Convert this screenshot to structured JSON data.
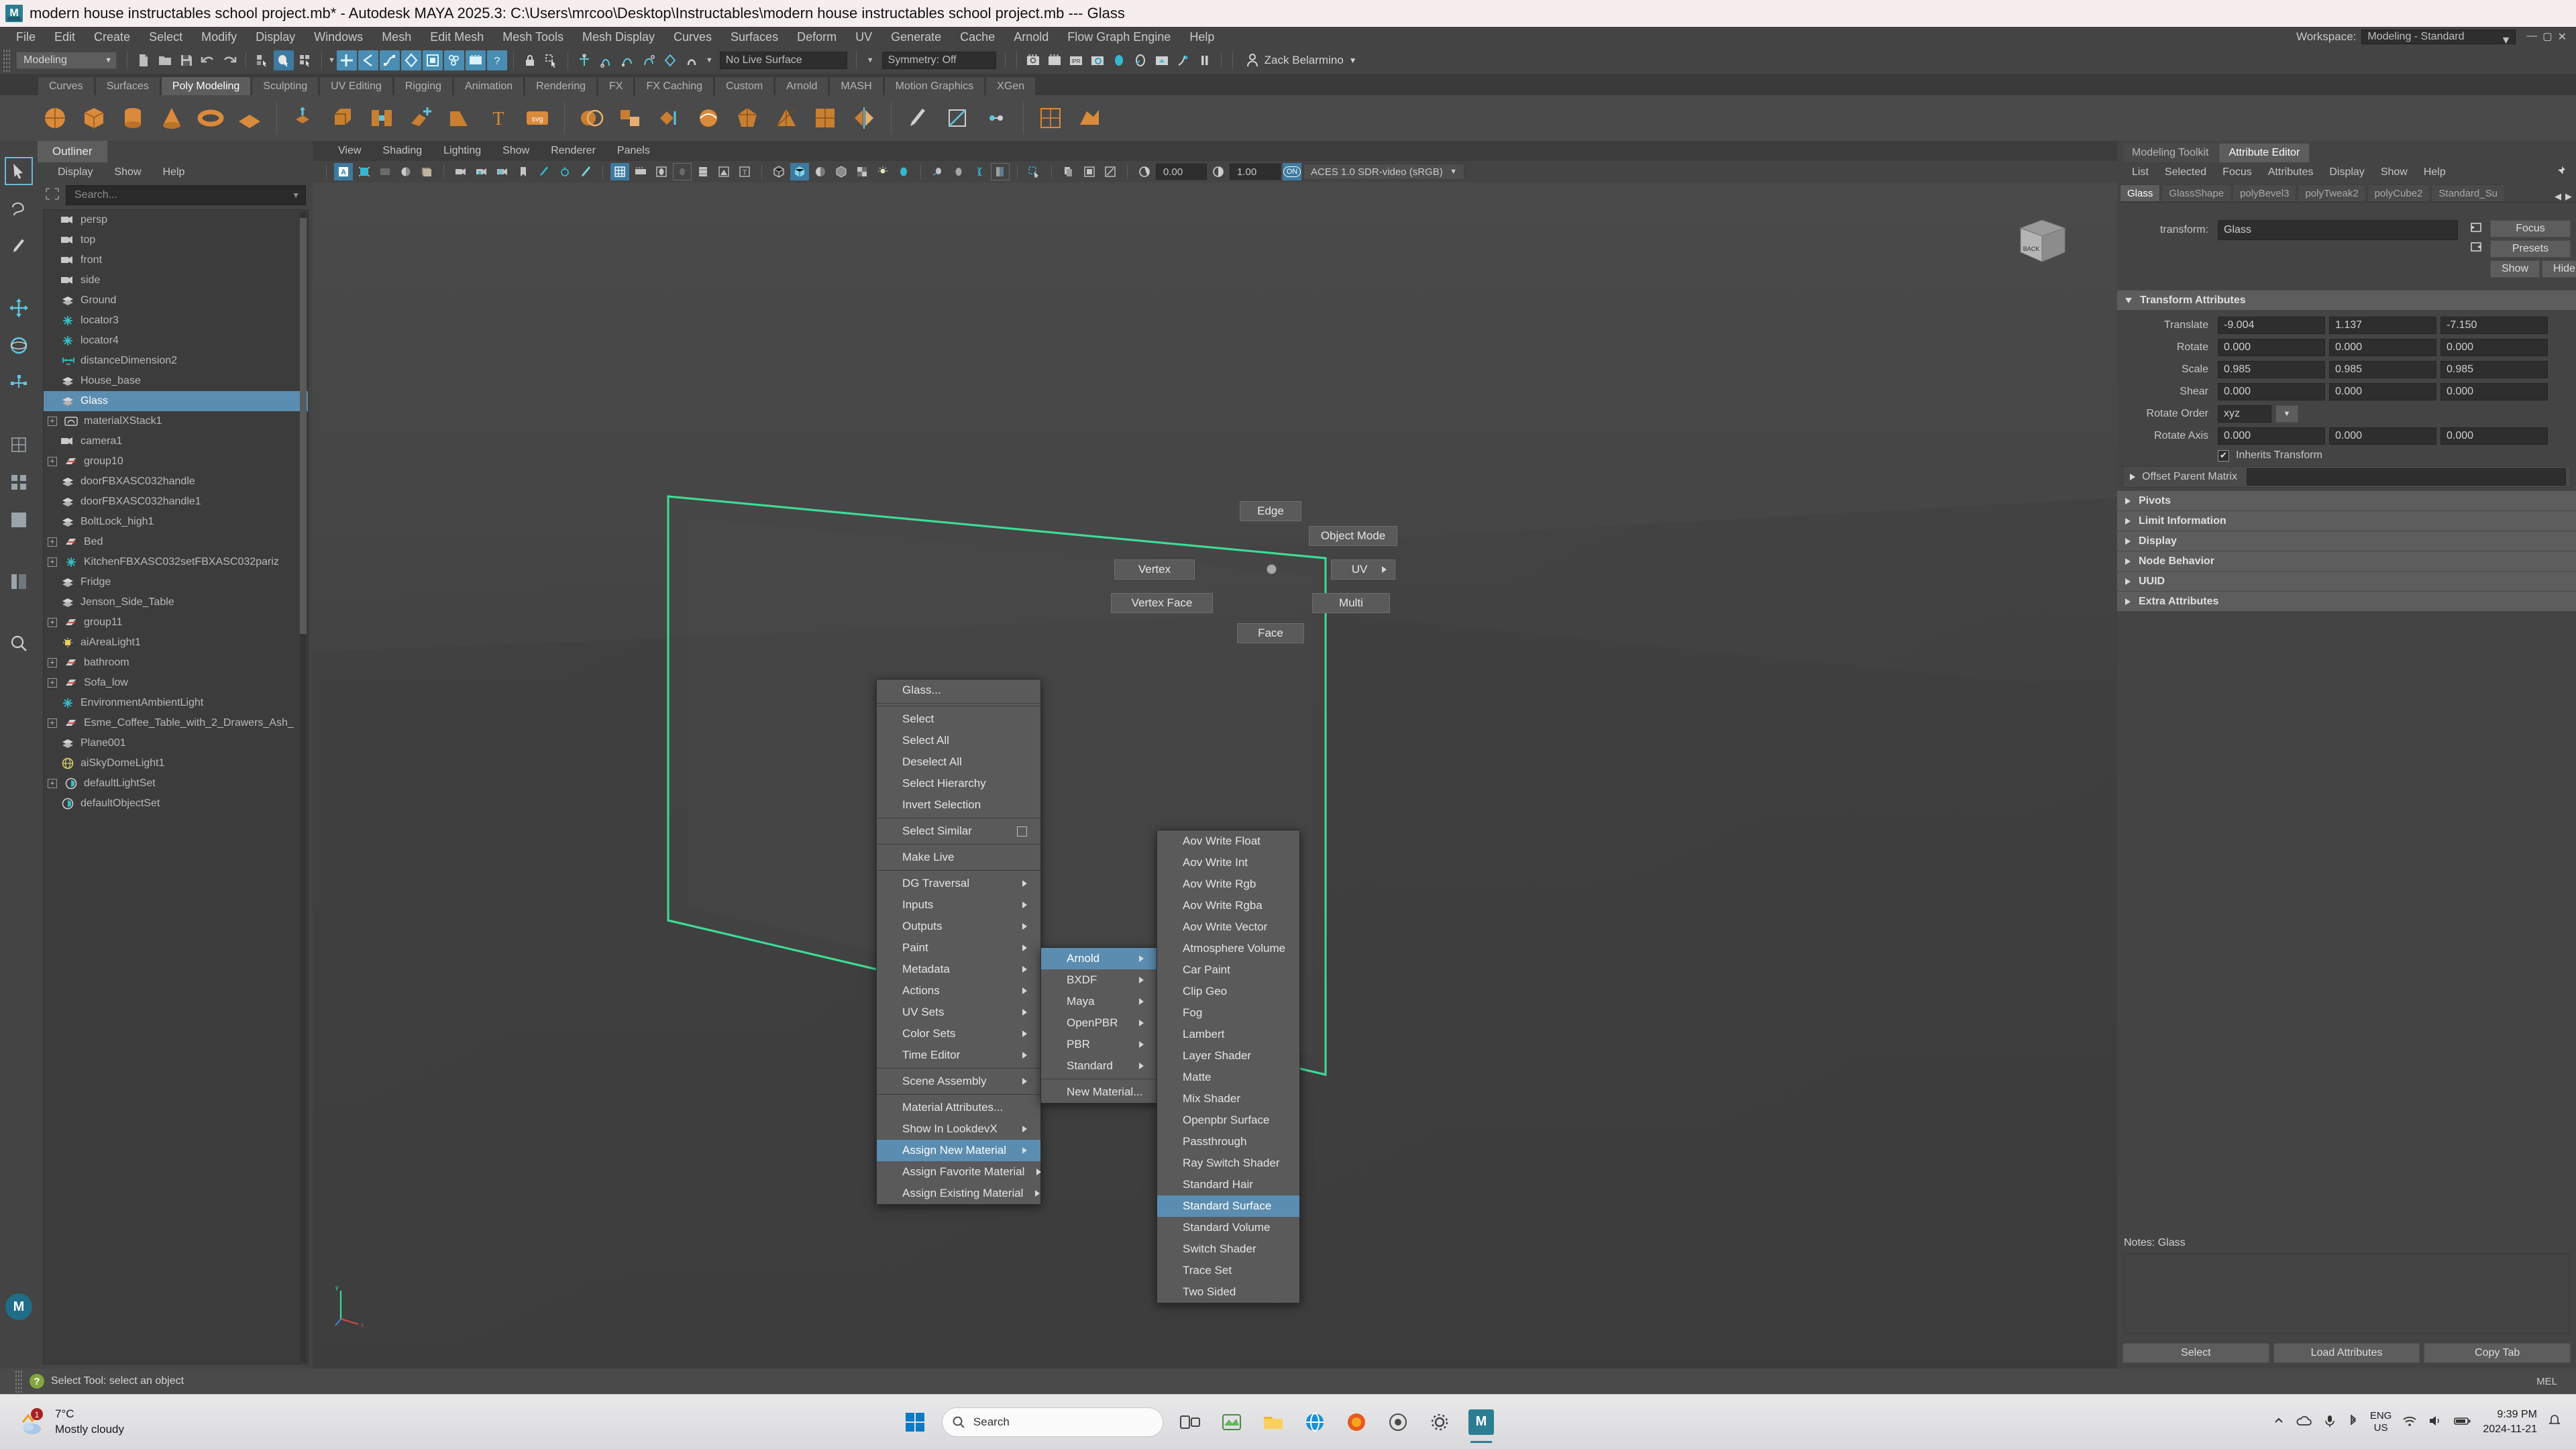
{
  "titlebar": {
    "text": "modern house instructables school project.mb* - Autodesk MAYA 2025.3: C:\\Users\\mrcoo\\Desktop\\Instructables\\modern house instructables school project.mb   ---   Glass",
    "logo": "M"
  },
  "menubar": {
    "items": [
      "File",
      "Edit",
      "Create",
      "Select",
      "Modify",
      "Display",
      "Windows",
      "Mesh",
      "Edit Mesh",
      "Mesh Tools",
      "Mesh Display",
      "Curves",
      "Surfaces",
      "Deform",
      "UV",
      "Generate",
      "Cache",
      "Arnold",
      "Flow Graph Engine",
      "Help"
    ],
    "workspace_label": "Workspace:",
    "workspace_value": "Modeling - Standard"
  },
  "statusline": {
    "menuset": "Modeling",
    "live_surface": "No Live Surface",
    "symmetry": "Symmetry: Off",
    "user": "Zack Belarmino"
  },
  "shelf": {
    "tabs": [
      "Curves",
      "Surfaces",
      "Poly Modeling",
      "Sculpting",
      "UV Editing",
      "Rigging",
      "Animation",
      "Rendering",
      "FX",
      "FX Caching",
      "Custom",
      "Arnold",
      "MASH",
      "Motion Graphics",
      "XGen"
    ],
    "active_tab": "Poly Modeling"
  },
  "outliner": {
    "tab": "Outliner",
    "menus": [
      "Display",
      "Show",
      "Help"
    ],
    "search_placeholder": "Search...",
    "items": [
      {
        "label": "persp",
        "icon": "camera-icon",
        "expandable": false,
        "selected": false
      },
      {
        "label": "top",
        "icon": "camera-icon",
        "expandable": false,
        "selected": false
      },
      {
        "label": "front",
        "icon": "camera-icon",
        "expandable": false,
        "selected": false
      },
      {
        "label": "side",
        "icon": "camera-icon",
        "expandable": false,
        "selected": false
      },
      {
        "label": "Ground",
        "icon": "mesh-icon",
        "expandable": false,
        "selected": false
      },
      {
        "label": "locator3",
        "icon": "locator-icon",
        "expandable": false,
        "selected": false
      },
      {
        "label": "locator4",
        "icon": "locator-icon",
        "expandable": false,
        "selected": false
      },
      {
        "label": "distanceDimension2",
        "icon": "distance-icon",
        "expandable": false,
        "selected": false
      },
      {
        "label": "House_base",
        "icon": "mesh-icon",
        "expandable": false,
        "selected": false
      },
      {
        "label": "Glass",
        "icon": "mesh-icon",
        "expandable": false,
        "selected": true
      },
      {
        "label": "materialXStack1",
        "icon": "materialx-icon",
        "expandable": true,
        "selected": false
      },
      {
        "label": "camera1",
        "icon": "camera-icon",
        "expandable": false,
        "selected": false
      },
      {
        "label": "group10",
        "icon": "group-icon",
        "expandable": true,
        "selected": false
      },
      {
        "label": "doorFBXASC032handle",
        "icon": "mesh-icon",
        "expandable": false,
        "selected": false
      },
      {
        "label": "doorFBXASC032handle1",
        "icon": "mesh-icon",
        "expandable": false,
        "selected": false
      },
      {
        "label": "BoltLock_high1",
        "icon": "mesh-icon",
        "expandable": false,
        "selected": false
      },
      {
        "label": "Bed",
        "icon": "group-icon",
        "expandable": true,
        "selected": false
      },
      {
        "label": "KitchenFBXASC032setFBXASC032pariz",
        "icon": "locator-icon",
        "expandable": true,
        "selected": false
      },
      {
        "label": "Fridge",
        "icon": "mesh-icon",
        "expandable": false,
        "selected": false
      },
      {
        "label": "Jenson_Side_Table",
        "icon": "mesh-icon",
        "expandable": false,
        "selected": false
      },
      {
        "label": "group11",
        "icon": "group-icon",
        "expandable": true,
        "selected": false
      },
      {
        "label": "aiAreaLight1",
        "icon": "arealight-icon",
        "expandable": false,
        "selected": false
      },
      {
        "label": "bathroom",
        "icon": "group-icon",
        "expandable": true,
        "selected": false
      },
      {
        "label": "Sofa_low",
        "icon": "group-icon",
        "expandable": true,
        "selected": false
      },
      {
        "label": "EnvironmentAmbientLight",
        "icon": "locator-icon",
        "expandable": false,
        "selected": false
      },
      {
        "label": "Esme_Coffee_Table_with_2_Drawers_Ash_",
        "icon": "group-icon",
        "expandable": true,
        "selected": false
      },
      {
        "label": "Plane001",
        "icon": "mesh-icon",
        "expandable": false,
        "selected": false
      },
      {
        "label": "aiSkyDomeLight1",
        "icon": "skydome-icon",
        "expandable": false,
        "selected": false
      },
      {
        "label": "defaultLightSet",
        "icon": "set-icon",
        "expandable": true,
        "selected": false
      },
      {
        "label": "defaultObjectSet",
        "icon": "set-icon",
        "expandable": false,
        "selected": false
      }
    ]
  },
  "viewport": {
    "menus": [
      "View",
      "Shading",
      "Lighting",
      "Show",
      "Renderer",
      "Panels"
    ],
    "exposure": "0.00",
    "gamma": "1.00",
    "color_toggle": "ON",
    "colorspace": "ACES 1.0 SDR-video (sRGB)",
    "viewcube_label": "BACK"
  },
  "marking_menu": {
    "edge": "Edge",
    "object_mode": "Object Mode",
    "vertex": "Vertex",
    "uv": "UV",
    "vertex_face": "Vertex Face",
    "multi": "Multi",
    "face": "Face"
  },
  "context_menu": {
    "header": "Glass...",
    "items": [
      {
        "label": "Select",
        "arrow": false,
        "sep_before": true
      },
      {
        "label": "Select All",
        "arrow": false
      },
      {
        "label": "Deselect All",
        "arrow": false
      },
      {
        "label": "Select Hierarchy",
        "arrow": false
      },
      {
        "label": "Invert Selection",
        "arrow": false
      },
      {
        "label": "Select Similar",
        "arrow": false,
        "checkbox": true,
        "sep_before": true
      },
      {
        "label": "Make Live",
        "arrow": false,
        "sep_before": true
      },
      {
        "label": "DG Traversal",
        "arrow": true,
        "sep_before": true
      },
      {
        "label": "Inputs",
        "arrow": true
      },
      {
        "label": "Outputs",
        "arrow": true
      },
      {
        "label": "Paint",
        "arrow": true
      },
      {
        "label": "Metadata",
        "arrow": true
      },
      {
        "label": "Actions",
        "arrow": true
      },
      {
        "label": "UV Sets",
        "arrow": true
      },
      {
        "label": "Color Sets",
        "arrow": true
      },
      {
        "label": "Time Editor",
        "arrow": true
      },
      {
        "label": "Scene Assembly",
        "arrow": true,
        "sep_before": true
      },
      {
        "label": "Material Attributes...",
        "arrow": false,
        "sep_before": true
      },
      {
        "label": "Show In LookdevX",
        "arrow": true
      },
      {
        "label": "Assign New Material",
        "arrow": true,
        "highlight": true
      },
      {
        "label": "Assign Favorite Material",
        "arrow": true
      },
      {
        "label": "Assign Existing Material",
        "arrow": true
      }
    ]
  },
  "submenu_material": {
    "items": [
      {
        "label": "Arnold",
        "arrow": true,
        "highlight": true
      },
      {
        "label": "BXDF",
        "arrow": true
      },
      {
        "label": "Maya",
        "arrow": true
      },
      {
        "label": "OpenPBR",
        "arrow": true
      },
      {
        "label": "PBR",
        "arrow": true
      },
      {
        "label": "Standard",
        "arrow": true
      },
      {
        "label": "New Material...",
        "arrow": false,
        "sep_before": true
      }
    ]
  },
  "submenu_arnold": {
    "items": [
      {
        "label": "Aov Write Float"
      },
      {
        "label": "Aov Write Int"
      },
      {
        "label": "Aov Write Rgb"
      },
      {
        "label": "Aov Write Rgba"
      },
      {
        "label": "Aov Write Vector"
      },
      {
        "label": "Atmosphere Volume"
      },
      {
        "label": "Car Paint"
      },
      {
        "label": "Clip Geo"
      },
      {
        "label": "Fog"
      },
      {
        "label": "Lambert"
      },
      {
        "label": "Layer Shader"
      },
      {
        "label": "Matte"
      },
      {
        "label": "Mix Shader"
      },
      {
        "label": "Openpbr Surface"
      },
      {
        "label": "Passthrough"
      },
      {
        "label": "Ray Switch Shader"
      },
      {
        "label": "Standard Hair"
      },
      {
        "label": "Standard Surface",
        "highlight": true
      },
      {
        "label": "Standard Volume"
      },
      {
        "label": "Switch Shader"
      },
      {
        "label": "Trace Set"
      },
      {
        "label": "Two Sided"
      }
    ]
  },
  "attribute_editor": {
    "tabs": [
      "Modeling Toolkit",
      "Attribute Editor"
    ],
    "active_tab": "Attribute Editor",
    "menus": [
      "List",
      "Selected",
      "Focus",
      "Attributes",
      "Display",
      "Show",
      "Help"
    ],
    "node_tabs": [
      "Glass",
      "GlassShape",
      "polyBevel3",
      "polyTweak2",
      "polyCube2",
      "Standard_Su"
    ],
    "active_node_tab": "Glass",
    "transform_label": "transform:",
    "transform_value": "Glass",
    "buttons": {
      "focus": "Focus",
      "presets": "Presets",
      "show": "Show",
      "hide": "Hide"
    },
    "section_title": "Transform Attributes",
    "rows": [
      {
        "label": "Translate",
        "values": [
          "-9.004",
          "1.137",
          "-7.150"
        ]
      },
      {
        "label": "Rotate",
        "values": [
          "0.000",
          "0.000",
          "0.000"
        ]
      },
      {
        "label": "Scale",
        "values": [
          "0.985",
          "0.985",
          "0.985"
        ]
      },
      {
        "label": "Shear",
        "values": [
          "0.000",
          "0.000",
          "0.000"
        ]
      }
    ],
    "rotate_order_label": "Rotate Order",
    "rotate_order_value": "xyz",
    "rotate_axis_label": "Rotate Axis",
    "rotate_axis_values": [
      "0.000",
      "0.000",
      "0.000"
    ],
    "inherits_label": "Inherits Transform",
    "offset_parent_label": "Offset Parent Matrix",
    "sections": [
      "Pivots",
      "Limit Information",
      "Display",
      "Node Behavior",
      "UUID",
      "Extra Attributes"
    ],
    "notes_label": "Notes: Glass",
    "footer": [
      "Select",
      "Load Attributes",
      "Copy Tab"
    ]
  },
  "command_line": {
    "mel_label": "MEL"
  },
  "help_line": {
    "text": "Select Tool: select an object"
  },
  "taskbar": {
    "weather_temp": "7°C",
    "weather_desc": "Mostly cloudy",
    "weather_badge": "1",
    "search_placeholder": "Search",
    "time": "9:39 PM",
    "date": "2024-11-21",
    "lang_primary": "ENG",
    "lang_secondary": "US"
  }
}
